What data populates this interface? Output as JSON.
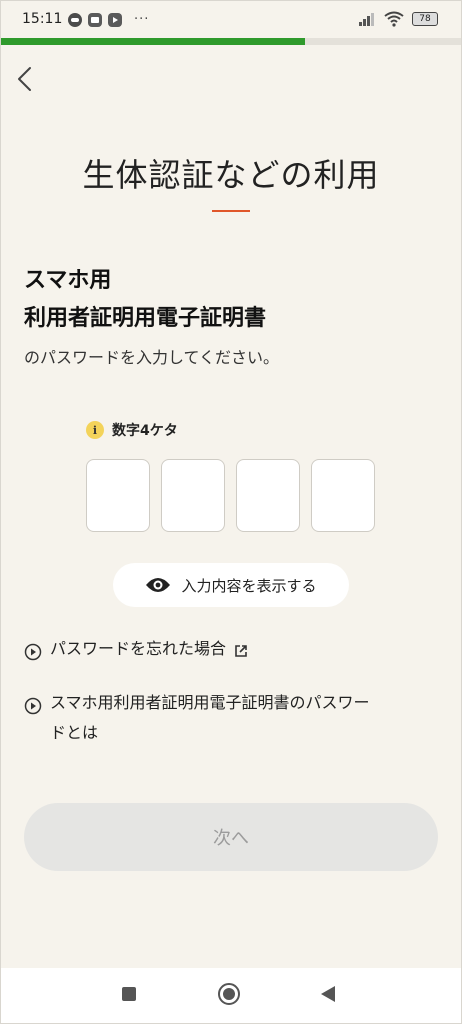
{
  "status_bar": {
    "time": "15:11",
    "more": "···",
    "battery": "78"
  },
  "progress": {
    "fraction": 0.66,
    "color": "#2f9a2c"
  },
  "title": "生体認証などの利用",
  "heading": {
    "line1": "スマホ用",
    "line2": "利用者証明用電子証明書"
  },
  "subtext": "のパスワードを入力してください。",
  "hint": {
    "icon": "info-icon",
    "text": "数字4ケタ"
  },
  "pin": {
    "digits": [
      "",
      "",
      "",
      ""
    ]
  },
  "show_button": {
    "icon": "eye-icon",
    "label": "入力内容を表示する"
  },
  "links": {
    "forgot": {
      "label": "パスワードを忘れた場合",
      "icon": "external-link-icon"
    },
    "about_line1": "スマホ用利用者証明用電子証明書のパスワー",
    "about_line2": "ドとは"
  },
  "next_button": {
    "label": "次へ"
  },
  "nav": {
    "icons": [
      "square-recents-icon",
      "circle-home-icon",
      "triangle-back-icon"
    ]
  },
  "colors": {
    "background": "#f6f3ec",
    "accent": "#e0562a",
    "progress": "#2f9a2c",
    "info": "#f3d35a"
  }
}
